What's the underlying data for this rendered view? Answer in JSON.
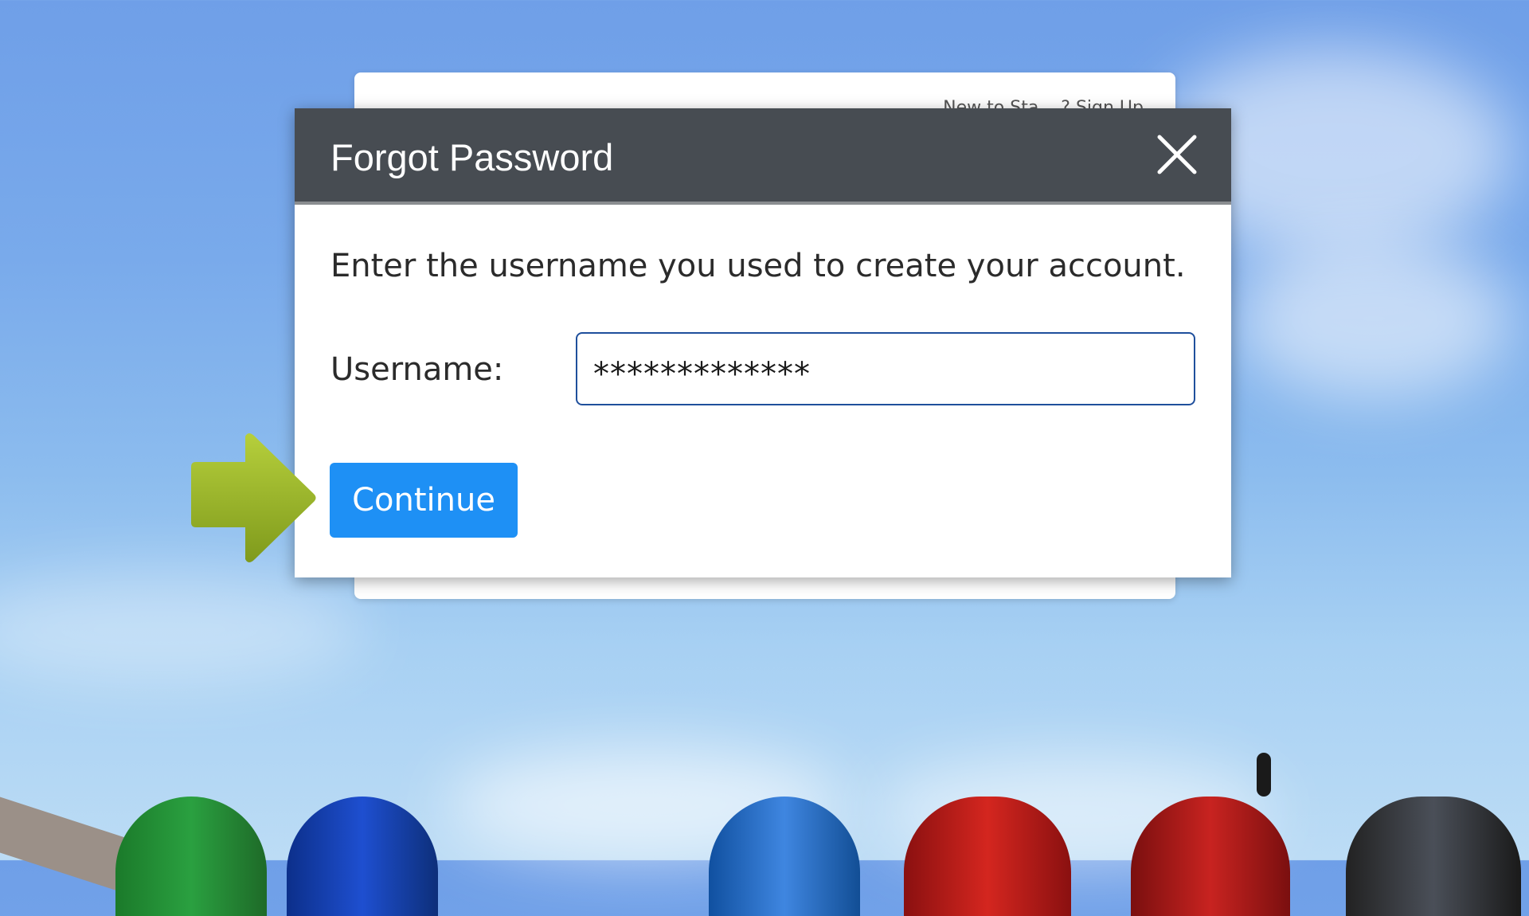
{
  "background": {
    "sky_color": "#79aaeb"
  },
  "back_panel": {
    "signup_hint": "New to Sta... ? Sign Up"
  },
  "modal": {
    "title": "Forgot Password",
    "close_icon": "close-icon",
    "instruction": "Enter the username you used to create your account.",
    "username_label": "Username:",
    "username_value": "*************",
    "continue_label": "Continue",
    "header_color": "#474c52",
    "button_color": "#1e90f5"
  },
  "annotation": {
    "arrow_icon": "right-arrow-icon",
    "arrow_color": "#9ab82a"
  }
}
